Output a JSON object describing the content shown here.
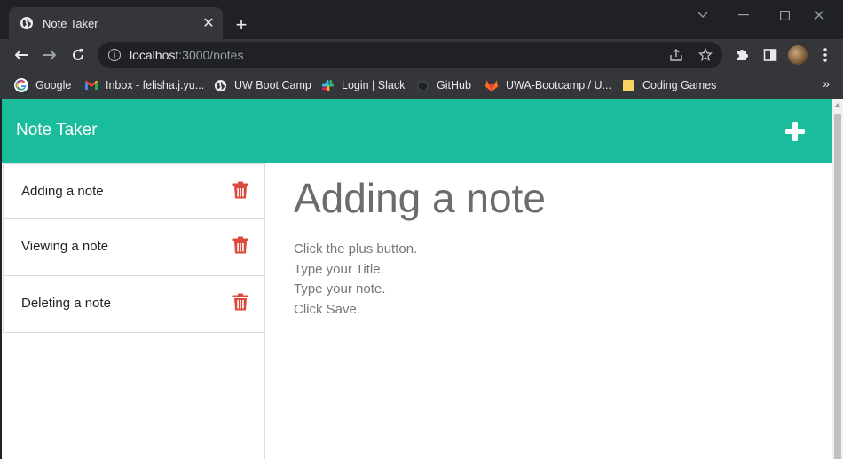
{
  "browser": {
    "tab_title": "Note Taker",
    "tab_close": "✕",
    "new_tab": "+",
    "url_host": "localhost",
    "url_rest": ":3000/notes",
    "bookmarks": [
      {
        "label": "Google",
        "icon": "google-icon"
      },
      {
        "label": "Inbox - felisha.j.yu...",
        "icon": "gmail-icon"
      },
      {
        "label": "UW Boot Camp",
        "icon": "globe-icon"
      },
      {
        "label": "Login | Slack",
        "icon": "slack-icon"
      },
      {
        "label": "GitHub",
        "icon": "github-icon"
      },
      {
        "label": "UWA-Bootcamp / U...",
        "icon": "gitlab-icon"
      },
      {
        "label": "Coding Games",
        "icon": "folder-icon"
      }
    ]
  },
  "app": {
    "brand": "Note Taker",
    "accent_color": "#19bc9b",
    "trash_color": "#dc4a3d",
    "notes": [
      {
        "title": "Adding a note"
      },
      {
        "title": "Viewing a note"
      },
      {
        "title": "Deleting a note"
      }
    ],
    "active_note": {
      "title": "Adding a note",
      "text": "Click the plus button.\nType your Title.\nType your note.\nClick Save."
    }
  }
}
